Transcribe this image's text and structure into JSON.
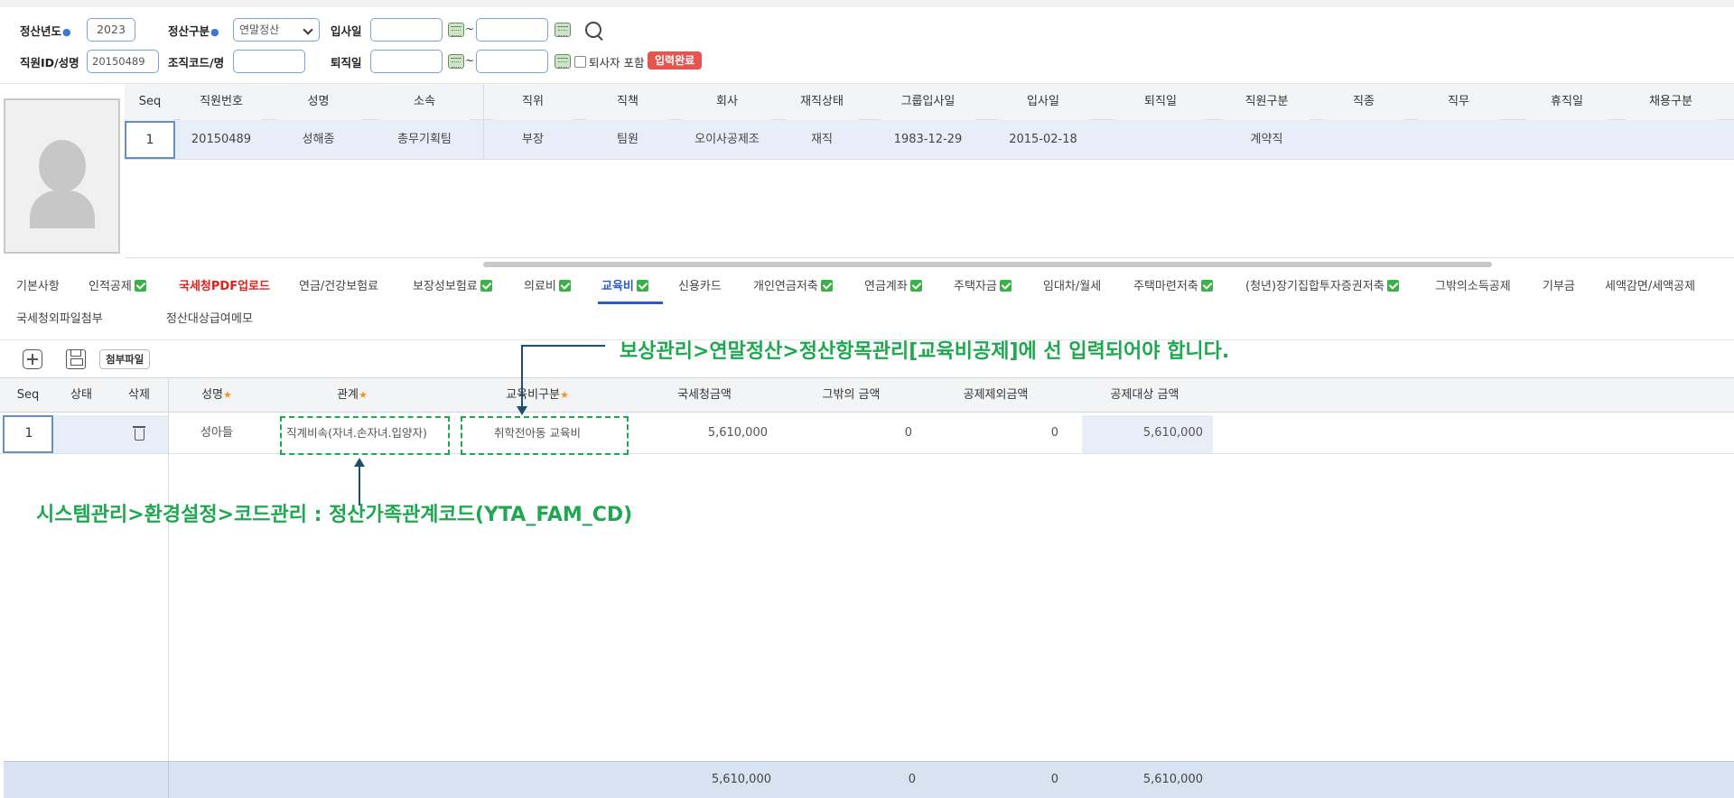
{
  "filter": {
    "year_label": "정산년도",
    "year_value": "2023",
    "type_label": "정산구분",
    "type_value": "연말정산",
    "join_label": "입사일",
    "join_from": "",
    "join_to": "",
    "range_sep": "~",
    "emp_label": "직원ID/성명",
    "emp_value": "20150489",
    "org_label": "조직코드/명",
    "org_value": "",
    "retire_label": "퇴직일",
    "retire_from": "",
    "retire_to": "",
    "include_retired_label": "퇴사자 포함",
    "status_badge": "입력완료"
  },
  "employee_grid": {
    "columns": [
      "Seq",
      "직원번호",
      "성명",
      "소속",
      "직위",
      "직책",
      "회사",
      "재직상태",
      "그룹입사일",
      "입사일",
      "퇴직일",
      "직원구분",
      "직종",
      "직무",
      "휴직일",
      "채용구분"
    ],
    "rows": [
      [
        "1",
        "20150489",
        "성해종",
        "총무기획팀",
        "부장",
        "팀원",
        "오이사공제조",
        "재직",
        "1983-12-29",
        "2015-02-18",
        "",
        "계약직",
        "",
        "",
        "",
        ""
      ]
    ]
  },
  "tabs": {
    "row1": [
      {
        "label": "기본사항",
        "check": false
      },
      {
        "label": "인적공제",
        "check": true
      },
      {
        "label": "국세청PDF업로드",
        "check": false
      },
      {
        "label": "연금/건강보험료",
        "check": false
      },
      {
        "label": "보장성보험료",
        "check": true
      },
      {
        "label": "의료비",
        "check": true
      },
      {
        "label": "교육비",
        "check": true
      },
      {
        "label": "신용카드",
        "check": false
      },
      {
        "label": "개인연금저축",
        "check": true
      },
      {
        "label": "연금계좌",
        "check": true
      },
      {
        "label": "주택자금",
        "check": true
      },
      {
        "label": "임대차/월세",
        "check": false
      },
      {
        "label": "주택마련저축",
        "check": true
      },
      {
        "label": "(청년)장기집합투자증권저축",
        "check": true
      },
      {
        "label": "그밖의소득공제",
        "check": false
      },
      {
        "label": "기부금",
        "check": false
      },
      {
        "label": "세액감면/세액공제",
        "check": false
      }
    ],
    "row2": [
      {
        "label": "국세청외파일첨부"
      },
      {
        "label": "정산대상급여"
      },
      {
        "label": "메모"
      }
    ],
    "active": "교육비"
  },
  "toolbar": {
    "attach_label": "첨부파일"
  },
  "detail_grid": {
    "columns": {
      "seq": "Seq",
      "status": "상태",
      "delete": "삭제",
      "name": "성명",
      "relation": "관계",
      "edu_type": "교육비구분",
      "nts_amount": "국세청금액",
      "other_amount": "그밖의 금액",
      "excluded_amount": "공제제외금액",
      "target_amount": "공제대상 금액"
    },
    "row": {
      "seq": "1",
      "status": "",
      "name": "성아들",
      "relation": "직계비속(자녀.손자녀.입양자)",
      "edu_type": "취학전아동 교육비",
      "nts_amount": "5,610,000",
      "other_amount": "0",
      "excluded_amount": "0",
      "target_amount": "5,610,000"
    },
    "totals": {
      "nts_amount": "5,610,000",
      "other_amount": "0",
      "excluded_amount": "0",
      "target_amount": "5,610,000"
    }
  },
  "annotations": {
    "edu_note": "보상관리>연말정산>정산항목관리[교육비공제]에 선 입력되어야 합니다.",
    "relation_note": "시스템관리>환경설정>코드관리 : 정산가족관계코드(YTA_FAM_CD)",
    "color": "#1fa850"
  },
  "colors": {
    "accent": "#2b5cc8",
    "check": "#3cb04a",
    "badge": "#e8534f",
    "selected_row": "#e8eef8"
  }
}
